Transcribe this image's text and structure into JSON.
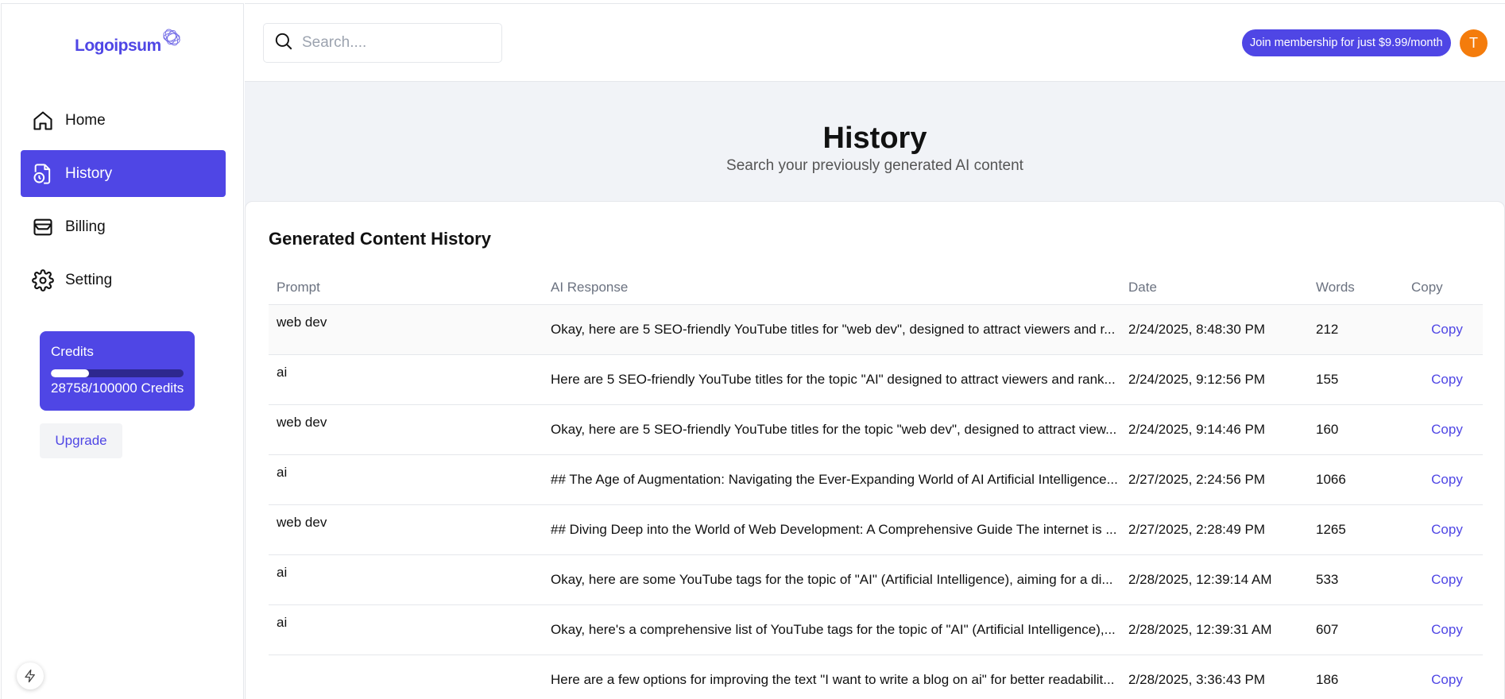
{
  "brand": {
    "name": "Logoipsum",
    "accent": "#4f46e5"
  },
  "sidebar": {
    "items": [
      {
        "label": "Home",
        "icon": "home-icon",
        "active": false
      },
      {
        "label": "History",
        "icon": "history-icon",
        "active": true
      },
      {
        "label": "Billing",
        "icon": "billing-icon",
        "active": false
      },
      {
        "label": "Setting",
        "icon": "settings-icon",
        "active": false
      }
    ],
    "credits": {
      "title": "Credits",
      "used": 28758,
      "total": 100000,
      "text": "28758/100000 Credits"
    },
    "upgrade_label": "Upgrade"
  },
  "header": {
    "search_placeholder": "Search....",
    "membership_label": "Join membership for just $9.99/month",
    "avatar_initial": "T",
    "avatar_color": "#f47c0c"
  },
  "page": {
    "title": "History",
    "subtitle": "Search your previously generated AI content"
  },
  "history": {
    "title": "Generated Content History",
    "columns": [
      "Prompt",
      "AI Response",
      "Date",
      "Words",
      "Copy"
    ],
    "rows": [
      {
        "prompt": "web dev",
        "response": "Okay, here are 5 SEO-friendly YouTube titles for \"web dev\", designed to attract viewers and r...",
        "date": "2/24/2025, 8:48:30 PM",
        "words": "212",
        "copy": "Copy"
      },
      {
        "prompt": "ai",
        "response": "Here are 5 SEO-friendly YouTube titles for the topic \"AI\" designed to attract viewers and rank...",
        "date": "2/24/2025, 9:12:56 PM",
        "words": "155",
        "copy": "Copy"
      },
      {
        "prompt": "web dev",
        "response": "Okay, here are 5 SEO-friendly YouTube titles for the topic \"web dev\", designed to attract view...",
        "date": "2/24/2025, 9:14:46 PM",
        "words": "160",
        "copy": "Copy"
      },
      {
        "prompt": "ai",
        "response": "## The Age of Augmentation: Navigating the Ever-Expanding World of AI Artificial Intelligence...",
        "date": "2/27/2025, 2:24:56 PM",
        "words": "1066",
        "copy": "Copy"
      },
      {
        "prompt": "web dev",
        "response": "## Diving Deep into the World of Web Development: A Comprehensive Guide The internet is ...",
        "date": "2/27/2025, 2:28:49 PM",
        "words": "1265",
        "copy": "Copy"
      },
      {
        "prompt": "ai",
        "response": "Okay, here are some YouTube tags for the topic of \"AI\" (Artificial Intelligence), aiming for a di...",
        "date": "2/28/2025, 12:39:14 AM",
        "words": "533",
        "copy": "Copy"
      },
      {
        "prompt": "ai",
        "response": "Okay, here's a comprehensive list of YouTube tags for the topic of \"AI\" (Artificial Intelligence),...",
        "date": "2/28/2025, 12:39:31 AM",
        "words": "607",
        "copy": "Copy"
      },
      {
        "prompt": "",
        "response": "Here are a few options for improving the text \"I want to write a blog on ai\" for better readabilit...",
        "date": "2/28/2025, 3:36:43 PM",
        "words": "186",
        "copy": "Copy"
      }
    ]
  }
}
